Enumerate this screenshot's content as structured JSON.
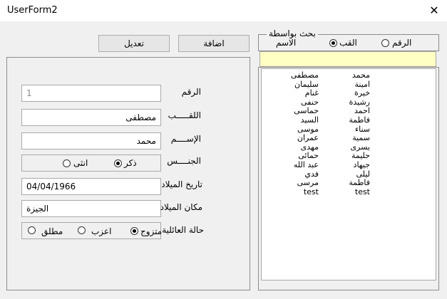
{
  "window": {
    "title": "UserForm2",
    "close_glyph": "✕"
  },
  "buttons": {
    "add": "اضافة",
    "edit": "تعديل"
  },
  "form": {
    "id": {
      "label": "الرقم",
      "value": "1"
    },
    "last_name": {
      "label": "اللقـــــب",
      "value": "مصطفى"
    },
    "first_name": {
      "label": "الإســــم",
      "value": "محمد"
    },
    "gender": {
      "label": "الجنــــس",
      "male": "ذكر",
      "female": "انثى",
      "selected": "male"
    },
    "birth_date": {
      "label": "تاريخ الميلاد",
      "value": "04/04/1966"
    },
    "birth_place": {
      "label": "مكان الميلاد",
      "value": "الجيزة"
    },
    "marital": {
      "label": "حالة العائلية",
      "married": "متزوج",
      "single": "اعزب",
      "divorced": "مطلق",
      "selected": "married"
    }
  },
  "search": {
    "legend": "بحث بواسطة",
    "by_number": "الرقم",
    "by_last": "القب",
    "by_first": "الاسم",
    "selected": "last",
    "query": ""
  },
  "list": {
    "rows": [
      {
        "first": "محمد",
        "last": "مصطفى"
      },
      {
        "first": "امينة",
        "last": "سليمان"
      },
      {
        "first": "خيرة",
        "last": "غنام"
      },
      {
        "first": "رشيدة",
        "last": "حنفى"
      },
      {
        "first": "احمد",
        "last": "حماسى"
      },
      {
        "first": "فاطمة",
        "last": "السيد"
      },
      {
        "first": "سناء",
        "last": "موسى"
      },
      {
        "first": "سمية",
        "last": "عمران"
      },
      {
        "first": "يسرى",
        "last": "مهدى"
      },
      {
        "first": "حليمة",
        "last": "حمائى"
      },
      {
        "first": "جيهاد",
        "last": "عبد الله"
      },
      {
        "first": "ليلى",
        "last": "فدي"
      },
      {
        "first": "فاطمة",
        "last": "مرسى"
      },
      {
        "first": "test",
        "last": "test"
      }
    ]
  }
}
